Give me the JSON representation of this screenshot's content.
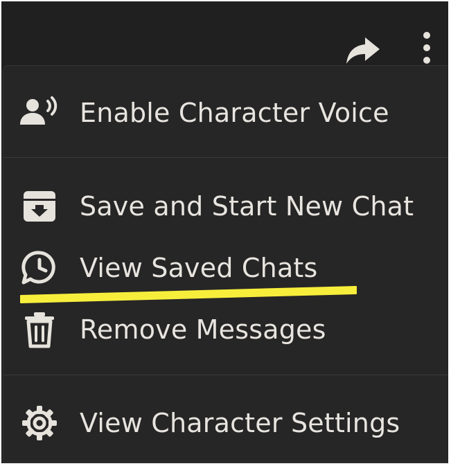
{
  "topbar": {
    "share_icon": "share-arrow-icon",
    "more_icon": "more-vertical-icon"
  },
  "menu": {
    "items": [
      {
        "label": "Enable Character Voice",
        "icon": "voice-speaker-icon"
      },
      {
        "label": "Save and Start New Chat",
        "icon": "archive-box-icon"
      },
      {
        "label": "View Saved Chats",
        "icon": "history-chat-icon"
      },
      {
        "label": "Remove Messages",
        "icon": "trash-icon"
      },
      {
        "label": "View Character Settings",
        "icon": "gear-icon"
      }
    ]
  },
  "colors": {
    "background": "#202020",
    "menu_background": "#262626",
    "text": "#e8e4df",
    "icon": "#e6e2dc",
    "highlight": "#f7ee3c"
  }
}
